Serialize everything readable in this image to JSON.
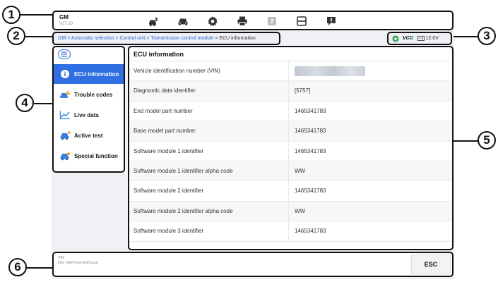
{
  "callouts": [
    "1",
    "2",
    "3",
    "4",
    "5",
    "6"
  ],
  "toolbar": {
    "brand": "GM",
    "version": "V17.10",
    "icons": [
      "car-home-icon",
      "car-icon",
      "gear-icon",
      "printer-icon",
      "help-icon",
      "save-icon",
      "feedback-icon"
    ]
  },
  "breadcrumb": {
    "links": [
      "GM",
      "Automatic selection",
      "Control unit",
      "Transmission control module"
    ],
    "separator": " > ",
    "current": "ECU information"
  },
  "status": {
    "vci_prefix": "VCI",
    "vci_suffix": "2",
    "voltage": "12.0V"
  },
  "sidebar": {
    "items": [
      {
        "label": "ECU information",
        "icon": "info-icon",
        "active": true
      },
      {
        "label": "Trouble codes",
        "icon": "car-alert-icon",
        "active": false
      },
      {
        "label": "Live data",
        "icon": "line-graph-icon",
        "active": false
      },
      {
        "label": "Active test",
        "icon": "car-test-icon",
        "active": false
      },
      {
        "label": "Special function",
        "icon": "car-function-icon",
        "active": false
      }
    ]
  },
  "main": {
    "title": "ECU information",
    "rows": [
      {
        "key": "Vehicle identification number (VIN)",
        "value": ""
      },
      {
        "key": "Diagnostic data identifier",
        "value": "[5757]"
      },
      {
        "key": "End model part number",
        "value": "1465341783"
      },
      {
        "key": "Base model part number",
        "value": "1465341783"
      },
      {
        "key": "Software module 1 identifier",
        "value": "1465341783"
      },
      {
        "key": "Software module 1 identifier alpha code",
        "value": "WW"
      },
      {
        "key": "Software module 2 identifier",
        "value": "1465341783"
      },
      {
        "key": "Software module 2 identifier alpha code",
        "value": "WW"
      },
      {
        "key": "Software module 3 identifier",
        "value": "1465341783"
      }
    ]
  },
  "footer": {
    "vin_label": "VIN:",
    "info": "Info: GM/Chevrolet/Cruze",
    "esc_label": "ESC"
  },
  "colors": {
    "accent": "#2f6fe3",
    "link": "#2d6be0",
    "vci_green": "#2aa04a"
  }
}
